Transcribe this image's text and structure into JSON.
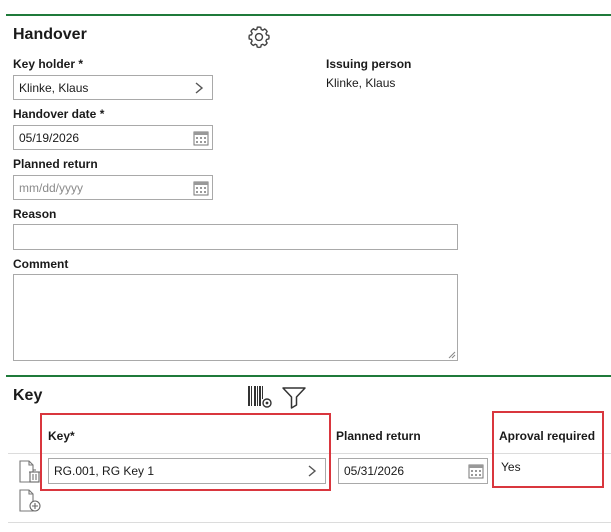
{
  "handover": {
    "title": "Handover",
    "settings_icon": "gear-icon",
    "key_holder": {
      "label": "Key holder *",
      "value": "Klinke, Klaus"
    },
    "issuing_person": {
      "label": "Issuing person",
      "value": "Klinke, Klaus"
    },
    "handover_date": {
      "label": "Handover date *",
      "value": "05/19/2026"
    },
    "planned_return": {
      "label": "Planned return",
      "placeholder": "mm/dd/yyyy"
    },
    "reason": {
      "label": "Reason",
      "value": ""
    },
    "comment": {
      "label": "Comment",
      "value": ""
    }
  },
  "key_section": {
    "title": "Key",
    "toolbar_icons": [
      "barcode-settings-icon",
      "filter-icon"
    ],
    "columns": {
      "key": "Key*",
      "planned_return": "Planned return",
      "approval": "Aproval required"
    },
    "rows": [
      {
        "key": "RG.001, RG Key 1",
        "planned_return": "05/31/2026",
        "approval_required": "Yes"
      }
    ],
    "row_actions": [
      "delete-document-icon",
      "add-document-icon"
    ]
  },
  "colors": {
    "accent_line": "#1f7a3a",
    "highlight": "#d9363e"
  }
}
